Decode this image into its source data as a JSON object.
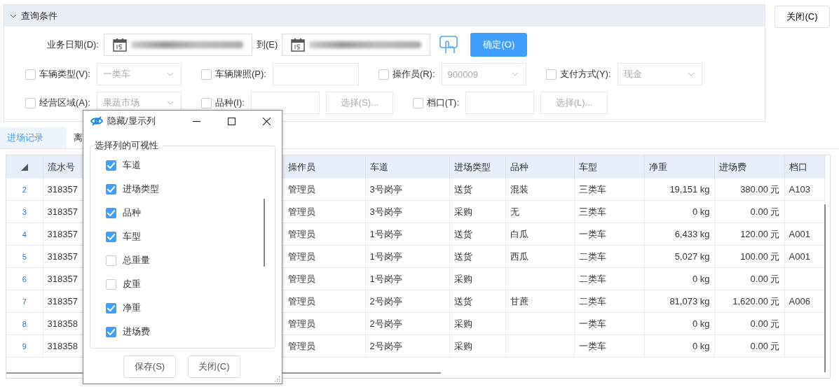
{
  "query_panel": {
    "title": "查询条件",
    "expanded": true,
    "date_row": {
      "label": "业务日期(D):",
      "to_label": "到(E)",
      "confirm_button": "确定(O)"
    },
    "filter_rows": [
      [
        {
          "kind": "select",
          "checked": false,
          "label": "车辆类型(V):",
          "value": "一类车",
          "disabled": true
        },
        {
          "kind": "text",
          "checked": false,
          "label": "车辆牌照(P):"
        },
        {
          "kind": "select",
          "checked": false,
          "label": "操作员(R):",
          "value": "900009",
          "disabled": true
        },
        {
          "kind": "select",
          "checked": false,
          "label": "支付方式(Y):",
          "value": "现金",
          "disabled": true
        }
      ],
      [
        {
          "kind": "select",
          "checked": false,
          "label": "经营区域(A):",
          "value": "果蔬市场",
          "disabled": true
        },
        {
          "kind": "picker",
          "checked": false,
          "label": "品种(I):",
          "button": "选择(S)..."
        },
        {
          "kind": "picker",
          "checked": false,
          "label": "档口(T):",
          "button": "选择(L)..."
        }
      ]
    ]
  },
  "close_button": "关闭(C)",
  "tabs": [
    {
      "label": "进场记录",
      "selected": true
    },
    {
      "label": "离",
      "selected": false
    }
  ],
  "table": {
    "columns": [
      {
        "label": "流水号",
        "kind": "text"
      },
      {
        "label": "操作员",
        "kind": "text"
      },
      {
        "label": "车道",
        "kind": "text"
      },
      {
        "label": "进场类型",
        "kind": "text"
      },
      {
        "label": "品种",
        "kind": "text"
      },
      {
        "label": "车型",
        "kind": "text"
      },
      {
        "label": "净重",
        "kind": "number"
      },
      {
        "label": "进场费",
        "kind": "number"
      },
      {
        "label": "档口",
        "kind": "text"
      }
    ],
    "rows": [
      {
        "index": "2",
        "cells": [
          "318357",
          "管理员",
          "3号岗亭",
          "送货",
          "混装",
          "三类车",
          "19,151 kg",
          "380.00 元",
          "A103"
        ]
      },
      {
        "index": "3",
        "cells": [
          "318357",
          "管理员",
          "3号岗亭",
          "采购",
          "无",
          "三类车",
          "0 kg",
          "0.00 元",
          ""
        ]
      },
      {
        "index": "4",
        "cells": [
          "318357",
          "管理员",
          "1号岗亭",
          "送货",
          "白瓜",
          "一类车",
          "6,433 kg",
          "120.00 元",
          "A001"
        ]
      },
      {
        "index": "5",
        "cells": [
          "318357",
          "管理员",
          "1号岗亭",
          "送货",
          "西瓜",
          "二类车",
          "5,027 kg",
          "100.00 元",
          "A001"
        ]
      },
      {
        "index": "6",
        "cells": [
          "318357",
          "管理员",
          "1号岗亭",
          "采购",
          "",
          "二类车",
          "0 kg",
          "0.00 元",
          ""
        ]
      },
      {
        "index": "7",
        "cells": [
          "318357",
          "管理员",
          "2号岗亭",
          "送货",
          "甘蔗",
          "二类车",
          "81,073 kg",
          "1,620.00 元",
          "A006"
        ]
      },
      {
        "index": "8",
        "cells": [
          "318358",
          "管理员",
          "2号岗亭",
          "采购",
          "",
          "一类车",
          "0 kg",
          "0.00 元",
          ""
        ]
      },
      {
        "index": "9",
        "cells": [
          "318358",
          "管理员",
          "2号岗亭",
          "采购",
          "",
          "一类车",
          "0 kg",
          "0.00 元",
          ""
        ]
      }
    ]
  },
  "dialog": {
    "title": "隐藏/显示列",
    "group_label": "选择列的可视性",
    "options": [
      {
        "label": "车道",
        "checked": true
      },
      {
        "label": "进场类型",
        "checked": true
      },
      {
        "label": "品种",
        "checked": true
      },
      {
        "label": "车型",
        "checked": true
      },
      {
        "label": "总重量",
        "checked": false
      },
      {
        "label": "皮重",
        "checked": false
      },
      {
        "label": "净重",
        "checked": true
      },
      {
        "label": "进场费",
        "checked": true
      }
    ],
    "buttons": [
      "保存(S)",
      "关闭(C)"
    ]
  }
}
